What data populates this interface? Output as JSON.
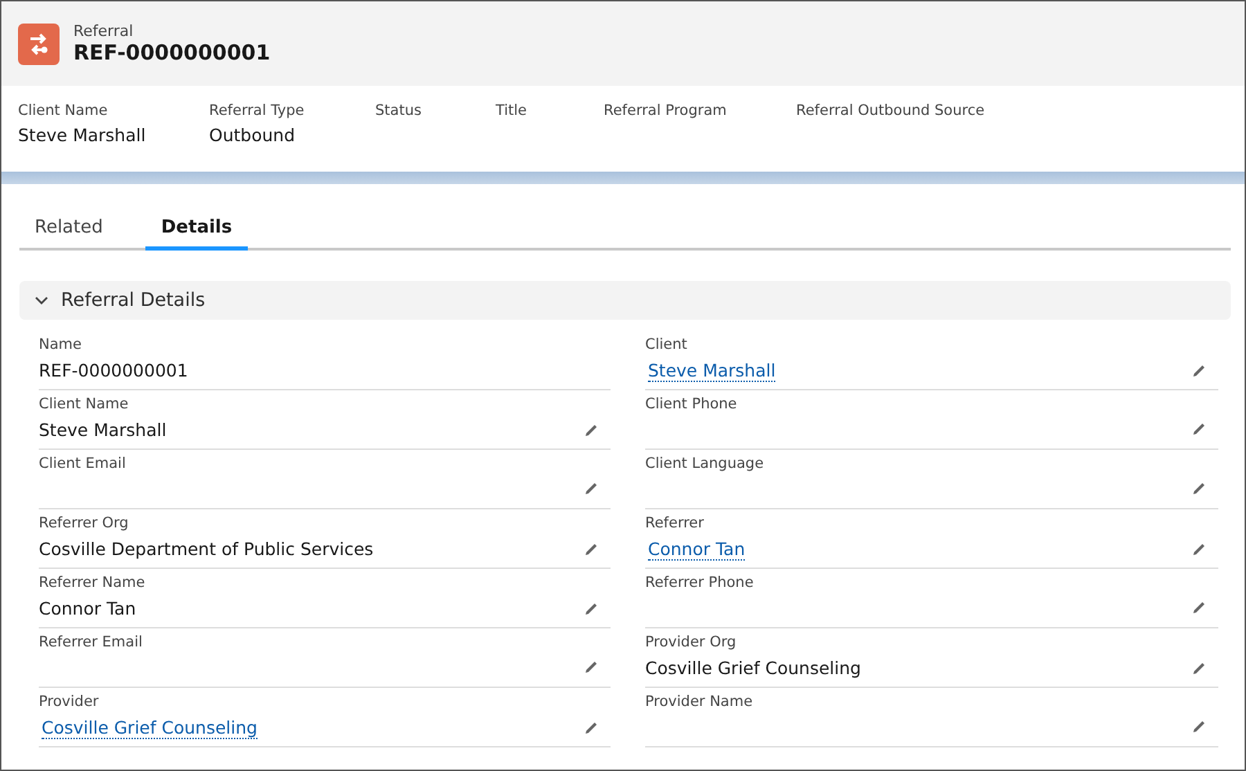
{
  "record": {
    "object": "Referral",
    "title": "REF-0000000001"
  },
  "highlights": [
    {
      "label": "Client Name",
      "value": "Steve Marshall"
    },
    {
      "label": "Referral Type",
      "value": "Outbound"
    },
    {
      "label": "Status"
    },
    {
      "label": "Title"
    },
    {
      "label": "Referral Program"
    },
    {
      "label": "Referral Outbound Source"
    }
  ],
  "tabs": [
    {
      "label": "Related",
      "selected": false
    },
    {
      "label": "Details",
      "selected": true
    }
  ],
  "section": {
    "title": "Referral Details",
    "expanded": true,
    "rows": [
      [
        {
          "label": "Name",
          "value": "REF-0000000001",
          "kind": "text",
          "editable": false
        },
        {
          "label": "Client",
          "value": "Steve Marshall",
          "kind": "link",
          "editable": true
        }
      ],
      [
        {
          "label": "Client Name",
          "value": "Steve Marshall",
          "kind": "text",
          "editable": true
        },
        {
          "label": "Client Phone",
          "editable": true
        }
      ],
      [
        {
          "label": "Client Email",
          "editable": true
        },
        {
          "label": "Client Language",
          "editable": true
        }
      ],
      [
        {
          "label": "Referrer Org",
          "value": "Cosville Department of Public Services",
          "kind": "text",
          "editable": true
        },
        {
          "label": "Referrer",
          "value": "Connor Tan",
          "kind": "link",
          "editable": true
        }
      ],
      [
        {
          "label": "Referrer Name",
          "value": "Connor Tan",
          "kind": "text",
          "editable": true
        },
        {
          "label": "Referrer Phone",
          "editable": true
        }
      ],
      [
        {
          "label": "Referrer Email",
          "editable": true
        },
        {
          "label": "Provider Org",
          "value": "Cosville Grief Counseling",
          "kind": "text",
          "editable": true
        }
      ],
      [
        {
          "label": "Provider",
          "value": "Cosville Grief Counseling",
          "kind": "link",
          "editable": true
        },
        {
          "label": "Provider Name",
          "editable": true
        }
      ]
    ]
  }
}
